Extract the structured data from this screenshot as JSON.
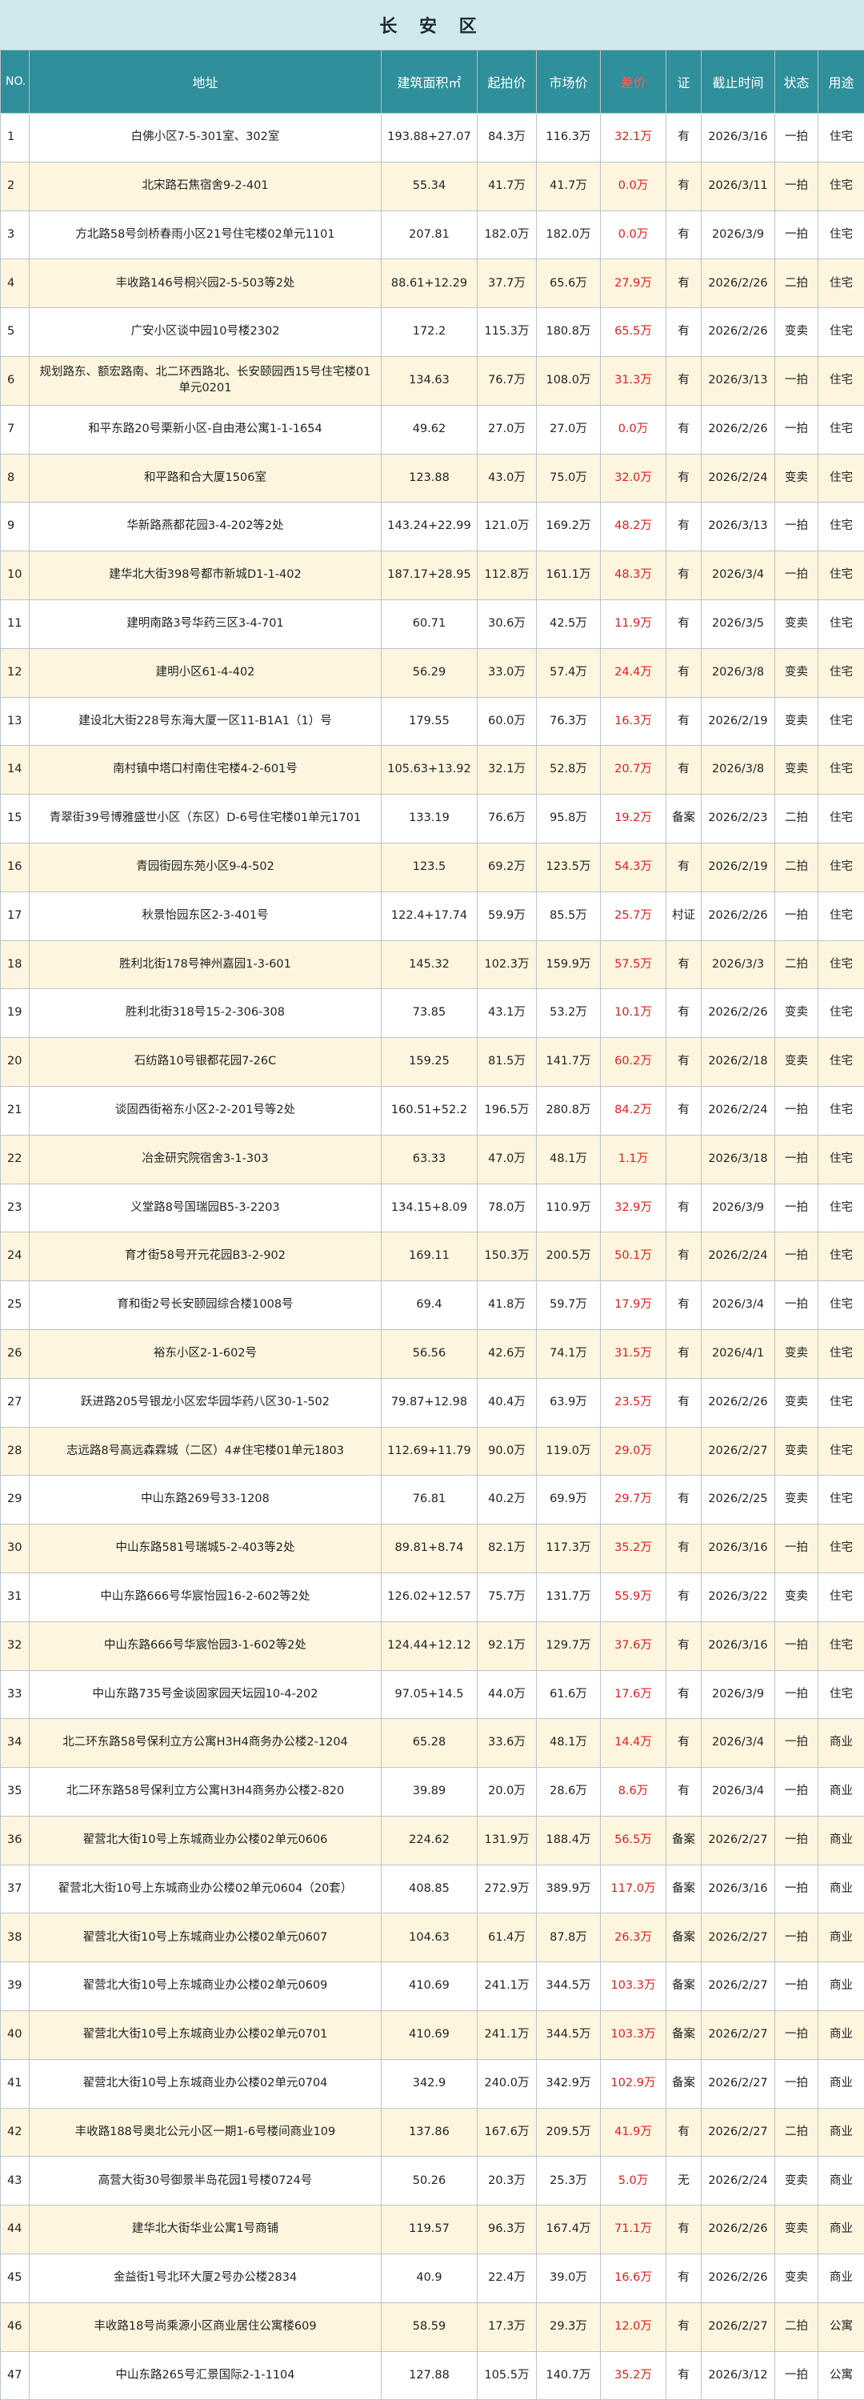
{
  "title": "长 安 区",
  "headers": {
    "no": "NO.",
    "address": "地址",
    "area": "建筑面积㎡",
    "start_price": "起拍价",
    "market_price": "市场价",
    "diff": "差价",
    "cert": "证",
    "deadline": "截止时间",
    "status": "状态",
    "usage": "用途"
  },
  "rows": [
    {
      "no": "1",
      "address": "白佛小区7-5-301室、302室",
      "area": "193.88+27.07",
      "start": "84.3万",
      "market": "116.3万",
      "diff": "32.1万",
      "cert": "有",
      "date": "2026/3/16",
      "status": "一拍",
      "usage": "住宅"
    },
    {
      "no": "2",
      "address": "北宋路石焦宿舍9-2-401",
      "area": "55.34",
      "start": "41.7万",
      "market": "41.7万",
      "diff": "0.0万",
      "cert": "有",
      "date": "2026/3/11",
      "status": "一拍",
      "usage": "住宅"
    },
    {
      "no": "3",
      "address": "方北路58号剑桥春雨小区21号住宅楼02单元1101",
      "area": "207.81",
      "start": "182.0万",
      "market": "182.0万",
      "diff": "0.0万",
      "cert": "有",
      "date": "2026/3/9",
      "status": "一拍",
      "usage": "住宅"
    },
    {
      "no": "4",
      "address": "丰收路146号桐兴园2-5-503等2处",
      "area": "88.61+12.29",
      "start": "37.7万",
      "market": "65.6万",
      "diff": "27.9万",
      "cert": "有",
      "date": "2026/2/26",
      "status": "二拍",
      "usage": "住宅"
    },
    {
      "no": "5",
      "address": "广安小区谈中园10号楼2302",
      "area": "172.2",
      "start": "115.3万",
      "market": "180.8万",
      "diff": "65.5万",
      "cert": "有",
      "date": "2026/2/26",
      "status": "变卖",
      "usage": "住宅"
    },
    {
      "no": "6",
      "address": "规划路东、额宏路南、北二环西路北、长安颐园西15号住宅楼01单元0201",
      "area": "134.63",
      "start": "76.7万",
      "market": "108.0万",
      "diff": "31.3万",
      "cert": "有",
      "date": "2026/3/13",
      "status": "一拍",
      "usage": "住宅"
    },
    {
      "no": "7",
      "address": "和平东路20号栗新小区-自由港公寓1-1-1654",
      "area": "49.62",
      "start": "27.0万",
      "market": "27.0万",
      "diff": "0.0万",
      "cert": "有",
      "date": "2026/2/26",
      "status": "一拍",
      "usage": "住宅"
    },
    {
      "no": "8",
      "address": "和平路和合大厦1506室",
      "area": "123.88",
      "start": "43.0万",
      "market": "75.0万",
      "diff": "32.0万",
      "cert": "有",
      "date": "2026/2/24",
      "status": "变卖",
      "usage": "住宅"
    },
    {
      "no": "9",
      "address": "华新路燕都花园3-4-202等2处",
      "area": "143.24+22.99",
      "start": "121.0万",
      "market": "169.2万",
      "diff": "48.2万",
      "cert": "有",
      "date": "2026/3/13",
      "status": "一拍",
      "usage": "住宅"
    },
    {
      "no": "10",
      "address": "建华北大街398号都市新城D1-1-402",
      "area": "187.17+28.95",
      "start": "112.8万",
      "market": "161.1万",
      "diff": "48.3万",
      "cert": "有",
      "date": "2026/3/4",
      "status": "一拍",
      "usage": "住宅"
    },
    {
      "no": "11",
      "address": "建明南路3号华药三区3-4-701",
      "area": "60.71",
      "start": "30.6万",
      "market": "42.5万",
      "diff": "11.9万",
      "cert": "有",
      "date": "2026/3/5",
      "status": "变卖",
      "usage": "住宅"
    },
    {
      "no": "12",
      "address": "建明小区61-4-402",
      "area": "56.29",
      "start": "33.0万",
      "market": "57.4万",
      "diff": "24.4万",
      "cert": "有",
      "date": "2026/3/8",
      "status": "变卖",
      "usage": "住宅"
    },
    {
      "no": "13",
      "address": "建设北大街228号东海大厦一区11-B1A1（1）号",
      "area": "179.55",
      "start": "60.0万",
      "market": "76.3万",
      "diff": "16.3万",
      "cert": "有",
      "date": "2026/2/19",
      "status": "变卖",
      "usage": "住宅"
    },
    {
      "no": "14",
      "address": "南村镇中塔口村南住宅楼4-2-601号",
      "area": "105.63+13.92",
      "start": "32.1万",
      "market": "52.8万",
      "diff": "20.7万",
      "cert": "有",
      "date": "2026/3/8",
      "status": "变卖",
      "usage": "住宅"
    },
    {
      "no": "15",
      "address": "青翠街39号博雅盛世小区（东区）D-6号住宅楼01单元1701",
      "area": "133.19",
      "start": "76.6万",
      "market": "95.8万",
      "diff": "19.2万",
      "cert": "备案",
      "date": "2026/2/23",
      "status": "二拍",
      "usage": "住宅"
    },
    {
      "no": "16",
      "address": "青园街园东苑小区9-4-502",
      "area": "123.5",
      "start": "69.2万",
      "market": "123.5万",
      "diff": "54.3万",
      "cert": "有",
      "date": "2026/2/19",
      "status": "二拍",
      "usage": "住宅"
    },
    {
      "no": "17",
      "address": "秋景怡园东区2-3-401号",
      "area": "122.4+17.74",
      "start": "59.9万",
      "market": "85.5万",
      "diff": "25.7万",
      "cert": "村证",
      "date": "2026/2/26",
      "status": "一拍",
      "usage": "住宅"
    },
    {
      "no": "18",
      "address": "胜利北街178号神州嘉园1-3-601",
      "area": "145.32",
      "start": "102.3万",
      "market": "159.9万",
      "diff": "57.5万",
      "cert": "有",
      "date": "2026/3/3",
      "status": "二拍",
      "usage": "住宅"
    },
    {
      "no": "19",
      "address": "胜利北街318号15-2-306-308",
      "area": "73.85",
      "start": "43.1万",
      "market": "53.2万",
      "diff": "10.1万",
      "cert": "有",
      "date": "2026/2/26",
      "status": "变卖",
      "usage": "住宅"
    },
    {
      "no": "20",
      "address": "石纺路10号银都花园7-26C",
      "area": "159.25",
      "start": "81.5万",
      "market": "141.7万",
      "diff": "60.2万",
      "cert": "有",
      "date": "2026/2/18",
      "status": "变卖",
      "usage": "住宅"
    },
    {
      "no": "21",
      "address": "谈固西街裕东小区2-2-201号等2处",
      "area": "160.51+52.2",
      "start": "196.5万",
      "market": "280.8万",
      "diff": "84.2万",
      "cert": "有",
      "date": "2026/2/24",
      "status": "一拍",
      "usage": "住宅"
    },
    {
      "no": "22",
      "address": "冶金研究院宿舍3-1-303",
      "area": "63.33",
      "start": "47.0万",
      "market": "48.1万",
      "diff": "1.1万",
      "cert": "",
      "date": "2026/3/18",
      "status": "一拍",
      "usage": "住宅"
    },
    {
      "no": "23",
      "address": "义堂路8号国瑞园B5-3-2203",
      "area": "134.15+8.09",
      "start": "78.0万",
      "market": "110.9万",
      "diff": "32.9万",
      "cert": "有",
      "date": "2026/3/9",
      "status": "一拍",
      "usage": "住宅"
    },
    {
      "no": "24",
      "address": "育才街58号开元花园B3-2-902",
      "area": "169.11",
      "start": "150.3万",
      "market": "200.5万",
      "diff": "50.1万",
      "cert": "有",
      "date": "2026/2/24",
      "status": "一拍",
      "usage": "住宅"
    },
    {
      "no": "25",
      "address": "育和街2号长安颐园综合楼1008号",
      "area": "69.4",
      "start": "41.8万",
      "market": "59.7万",
      "diff": "17.9万",
      "cert": "有",
      "date": "2026/3/4",
      "status": "一拍",
      "usage": "住宅"
    },
    {
      "no": "26",
      "address": "裕东小区2-1-602号",
      "area": "56.56",
      "start": "42.6万",
      "market": "74.1万",
      "diff": "31.5万",
      "cert": "有",
      "date": "2026/4/1",
      "status": "变卖",
      "usage": "住宅"
    },
    {
      "no": "27",
      "address": "跃进路205号银龙小区宏华园华药八区30-1-502",
      "area": "79.87+12.98",
      "start": "40.4万",
      "market": "63.9万",
      "diff": "23.5万",
      "cert": "有",
      "date": "2026/2/26",
      "status": "变卖",
      "usage": "住宅"
    },
    {
      "no": "28",
      "address": "志远路8号高远森霖城（二区）4#住宅楼01单元1803",
      "area": "112.69+11.79",
      "start": "90.0万",
      "market": "119.0万",
      "diff": "29.0万",
      "cert": "",
      "date": "2026/2/27",
      "status": "变卖",
      "usage": "住宅"
    },
    {
      "no": "29",
      "address": "中山东路269号33-1208",
      "area": "76.81",
      "start": "40.2万",
      "market": "69.9万",
      "diff": "29.7万",
      "cert": "有",
      "date": "2026/2/25",
      "status": "变卖",
      "usage": "住宅"
    },
    {
      "no": "30",
      "address": "中山东路581号瑞城5-2-403等2处",
      "area": "89.81+8.74",
      "start": "82.1万",
      "market": "117.3万",
      "diff": "35.2万",
      "cert": "有",
      "date": "2026/3/16",
      "status": "一拍",
      "usage": "住宅"
    },
    {
      "no": "31",
      "address": "中山东路666号华宸怡园16-2-602等2处",
      "area": "126.02+12.57",
      "start": "75.7万",
      "market": "131.7万",
      "diff": "55.9万",
      "cert": "有",
      "date": "2026/3/22",
      "status": "变卖",
      "usage": "住宅"
    },
    {
      "no": "32",
      "address": "中山东路666号华宸怡园3-1-602等2处",
      "area": "124.44+12.12",
      "start": "92.1万",
      "market": "129.7万",
      "diff": "37.6万",
      "cert": "有",
      "date": "2026/3/16",
      "status": "一拍",
      "usage": "住宅"
    },
    {
      "no": "33",
      "address": "中山东路735号金谈固家园天坛园10-4-202",
      "area": "97.05+14.5",
      "start": "44.0万",
      "market": "61.6万",
      "diff": "17.6万",
      "cert": "有",
      "date": "2026/3/9",
      "status": "一拍",
      "usage": "住宅"
    },
    {
      "no": "34",
      "address": "北二环东路58号保利立方公寓H3H4商务办公楼2-1204",
      "area": "65.28",
      "start": "33.6万",
      "market": "48.1万",
      "diff": "14.4万",
      "cert": "有",
      "date": "2026/3/4",
      "status": "一拍",
      "usage": "商业"
    },
    {
      "no": "35",
      "address": "北二环东路58号保利立方公寓H3H4商务办公楼2-820",
      "area": "39.89",
      "start": "20.0万",
      "market": "28.6万",
      "diff": "8.6万",
      "cert": "有",
      "date": "2026/3/4",
      "status": "一拍",
      "usage": "商业"
    },
    {
      "no": "36",
      "address": "翟营北大街10号上东城商业办公楼02单元0606",
      "area": "224.62",
      "start": "131.9万",
      "market": "188.4万",
      "diff": "56.5万",
      "cert": "备案",
      "date": "2026/2/27",
      "status": "一拍",
      "usage": "商业"
    },
    {
      "no": "37",
      "address": "翟营北大街10号上东城商业办公楼02单元0604（20套）",
      "area": "408.85",
      "start": "272.9万",
      "market": "389.9万",
      "diff": "117.0万",
      "cert": "备案",
      "date": "2026/3/16",
      "status": "一拍",
      "usage": "商业"
    },
    {
      "no": "38",
      "address": "翟营北大街10号上东城商业办公楼02单元0607",
      "area": "104.63",
      "start": "61.4万",
      "market": "87.8万",
      "diff": "26.3万",
      "cert": "备案",
      "date": "2026/2/27",
      "status": "一拍",
      "usage": "商业"
    },
    {
      "no": "39",
      "address": "翟营北大街10号上东城商业办公楼02单元0609",
      "area": "410.69",
      "start": "241.1万",
      "market": "344.5万",
      "diff": "103.3万",
      "cert": "备案",
      "date": "2026/2/27",
      "status": "一拍",
      "usage": "商业"
    },
    {
      "no": "40",
      "address": "翟营北大街10号上东城商业办公楼02单元0701",
      "area": "410.69",
      "start": "241.1万",
      "market": "344.5万",
      "diff": "103.3万",
      "cert": "备案",
      "date": "2026/2/27",
      "status": "一拍",
      "usage": "商业"
    },
    {
      "no": "41",
      "address": "翟营北大街10号上东城商业办公楼02单元0704",
      "area": "342.9",
      "start": "240.0万",
      "market": "342.9万",
      "diff": "102.9万",
      "cert": "备案",
      "date": "2026/2/27",
      "status": "一拍",
      "usage": "商业"
    },
    {
      "no": "42",
      "address": "丰收路188号奥北公元小区一期1-6号楼间商业109",
      "area": "137.86",
      "start": "167.6万",
      "market": "209.5万",
      "diff": "41.9万",
      "cert": "有",
      "date": "2026/2/27",
      "status": "二拍",
      "usage": "商业"
    },
    {
      "no": "43",
      "address": "高营大街30号御景半岛花园1号楼0724号",
      "area": "50.26",
      "start": "20.3万",
      "market": "25.3万",
      "diff": "5.0万",
      "cert": "无",
      "date": "2026/2/24",
      "status": "变卖",
      "usage": "商业"
    },
    {
      "no": "44",
      "address": "建华北大街华业公寓1号商铺",
      "area": "119.57",
      "start": "96.3万",
      "market": "167.4万",
      "diff": "71.1万",
      "cert": "有",
      "date": "2026/2/26",
      "status": "变卖",
      "usage": "商业"
    },
    {
      "no": "45",
      "address": "金益街1号北环大厦2号办公楼2834",
      "area": "40.9",
      "start": "22.4万",
      "market": "39.0万",
      "diff": "16.6万",
      "cert": "有",
      "date": "2026/2/26",
      "status": "变卖",
      "usage": "商业"
    },
    {
      "no": "46",
      "address": "丰收路18号尚乘源小区商业居住公寓楼609",
      "area": "58.59",
      "start": "17.3万",
      "market": "29.3万",
      "diff": "12.0万",
      "cert": "有",
      "date": "2026/2/27",
      "status": "二拍",
      "usage": "公寓"
    },
    {
      "no": "47",
      "address": "中山东路265号汇景国际2-1-1104",
      "area": "127.88",
      "start": "105.5万",
      "market": "140.7万",
      "diff": "35.2万",
      "cert": "有",
      "date": "2026/3/12",
      "status": "一拍",
      "usage": "公寓"
    }
  ]
}
